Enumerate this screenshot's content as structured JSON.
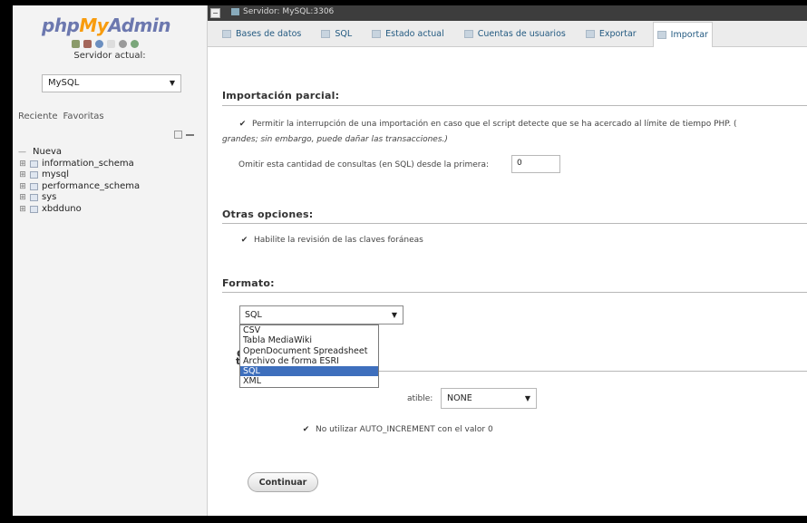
{
  "sidebar": {
    "logo": {
      "php": "php",
      "my": "My",
      "admin": "Admin"
    },
    "server_label": "Servidor actual:",
    "server_value": "MySQL",
    "recent_label": "Reciente",
    "favorites_label": "Favoritas",
    "tree": [
      {
        "label": "Nueva",
        "type": "new"
      },
      {
        "label": "information_schema",
        "type": "db"
      },
      {
        "label": "mysql",
        "type": "db"
      },
      {
        "label": "performance_schema",
        "type": "db"
      },
      {
        "label": "sys",
        "type": "db"
      },
      {
        "label": "xbddunо",
        "type": "db"
      }
    ]
  },
  "topbar": {
    "breadcrumb": "Servidor: MySQL:3306"
  },
  "tabs": [
    {
      "label": "Bases de datos"
    },
    {
      "label": "SQL"
    },
    {
      "label": "Estado actual"
    },
    {
      "label": "Cuentas de usuarios"
    },
    {
      "label": "Exportar"
    },
    {
      "label": "Importar"
    }
  ],
  "partial_import": {
    "title": "Importación parcial:",
    "allow_interrupt_line1": "Permitir la interrupción de una importación en caso que el script detecte que se ha acercado al límite de tiempo PHP. (",
    "allow_interrupt_line2": "grandes; sin embargo, puede dañar las transacciones.)",
    "skip_label": "Omitir esta cantidad de consultas (en SQL) desde la primera:",
    "skip_value": "0"
  },
  "other_options": {
    "title": "Otras opciones:",
    "foreign_keys_label": "Habilite la revisión de las claves foráneas"
  },
  "format": {
    "title": "Formato:",
    "selected": "SQL",
    "options": [
      "CSV",
      "Tabla MediaWiki",
      "OpenDocument Spreadsheet",
      "Archivo de forma ESRI",
      "SQL",
      "XML"
    ]
  },
  "format_options": {
    "title_fragment": "to:",
    "compat_fragment": "atible:",
    "compat_value": "NONE",
    "auto_increment_label": "No utilizar AUTO_INCREMENT con el valor 0"
  },
  "actions": {
    "continue_label": "Continuar"
  },
  "colors": {
    "accent": "#235a81",
    "selected": "#3e6fbd",
    "topbar": "#3d3d3d"
  }
}
